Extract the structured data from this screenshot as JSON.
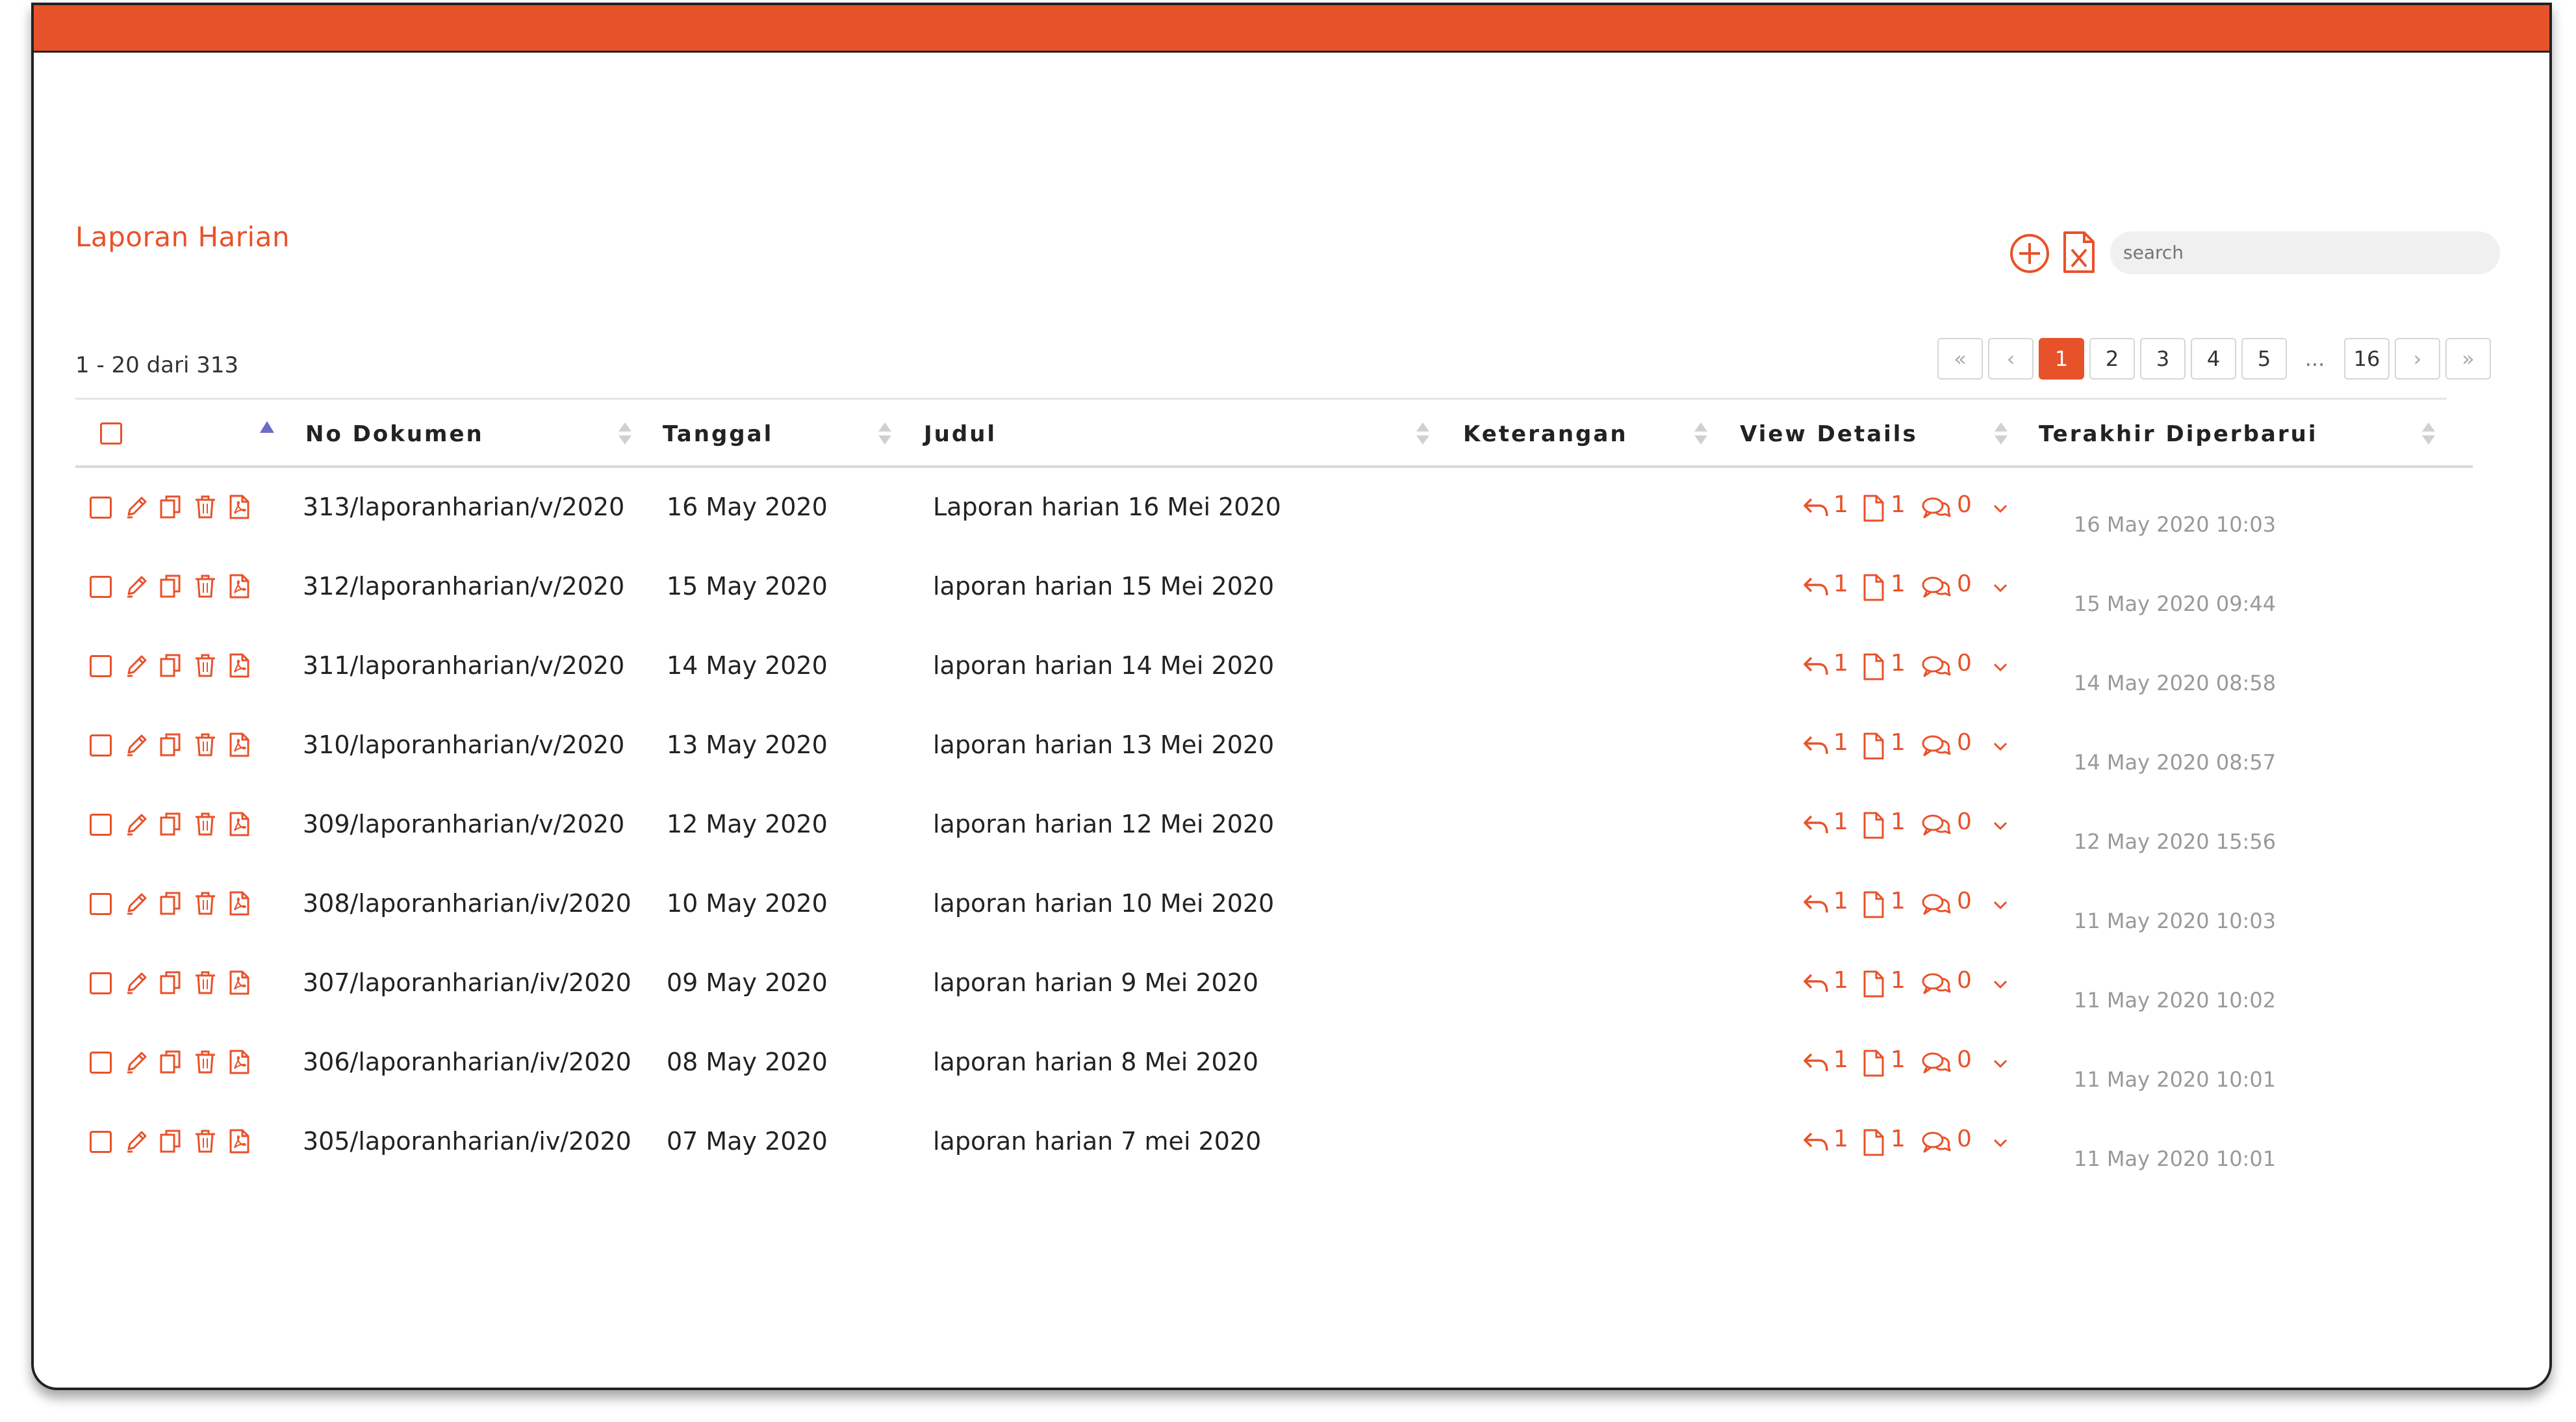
{
  "header": {
    "title": "Laporan Harian"
  },
  "search": {
    "placeholder": "search"
  },
  "range_text": "1 - 20 dari 313",
  "pagination": {
    "first": "«",
    "prev": "‹",
    "pages": [
      "1",
      "2",
      "3",
      "4",
      "5"
    ],
    "active": "1",
    "ellipsis": "...",
    "last_page": "16",
    "next": "›",
    "last": "»"
  },
  "table": {
    "columns": [
      "No Dokumen",
      "Tanggal",
      "Judul",
      "Keterangan",
      "View Details",
      "Terakhir Diperbarui"
    ],
    "rows": [
      {
        "no": "313/laporanharian/v/2020",
        "tanggal": "16 May 2020",
        "judul": "Laporan harian 16 Mei 2020",
        "keterangan": "",
        "reply": "1",
        "file": "1",
        "comment": "0",
        "updated": "16 May 2020 10:03"
      },
      {
        "no": "312/laporanharian/v/2020",
        "tanggal": "15 May 2020",
        "judul": "laporan harian 15 Mei 2020",
        "keterangan": "",
        "reply": "1",
        "file": "1",
        "comment": "0",
        "updated": "15 May 2020 09:44"
      },
      {
        "no": "311/laporanharian/v/2020",
        "tanggal": "14 May 2020",
        "judul": "laporan harian 14 Mei 2020",
        "keterangan": "",
        "reply": "1",
        "file": "1",
        "comment": "0",
        "updated": "14 May 2020 08:58"
      },
      {
        "no": "310/laporanharian/v/2020",
        "tanggal": "13 May 2020",
        "judul": "laporan harian 13 Mei 2020",
        "keterangan": "",
        "reply": "1",
        "file": "1",
        "comment": "0",
        "updated": "14 May 2020 08:57"
      },
      {
        "no": "309/laporanharian/v/2020",
        "tanggal": "12 May 2020",
        "judul": "laporan harian 12 Mei 2020",
        "keterangan": "",
        "reply": "1",
        "file": "1",
        "comment": "0",
        "updated": "12 May 2020 15:56"
      },
      {
        "no": "308/laporanharian/iv/2020",
        "tanggal": "10 May 2020",
        "judul": "laporan harian 10 Mei 2020",
        "keterangan": "",
        "reply": "1",
        "file": "1",
        "comment": "0",
        "updated": "11 May 2020 10:03"
      },
      {
        "no": "307/laporanharian/iv/2020",
        "tanggal": "09 May 2020",
        "judul": "laporan harian 9 Mei 2020",
        "keterangan": "",
        "reply": "1",
        "file": "1",
        "comment": "0",
        "updated": "11 May 2020 10:02"
      },
      {
        "no": "306/laporanharian/iv/2020",
        "tanggal": "08 May 2020",
        "judul": "laporan harian 8 Mei 2020",
        "keterangan": "",
        "reply": "1",
        "file": "1",
        "comment": "0",
        "updated": "11 May 2020 10:01"
      },
      {
        "no": "305/laporanharian/iv/2020",
        "tanggal": "07 May 2020",
        "judul": "laporan harian 7 mei 2020",
        "keterangan": "",
        "reply": "1",
        "file": "1",
        "comment": "0",
        "updated": "11 May 2020 10:01"
      }
    ]
  },
  "icons": {
    "add": "plus-circle-icon",
    "export": "excel-file-icon",
    "row_actions": [
      "checkbox",
      "edit-icon",
      "copy-icon",
      "delete-icon",
      "pdf-icon"
    ],
    "details": [
      "reply-icon",
      "file-icon",
      "comment-icon",
      "chevron-down-icon"
    ]
  },
  "colors": {
    "accent": "#e8522a",
    "muted": "#999999",
    "text": "#222222"
  }
}
